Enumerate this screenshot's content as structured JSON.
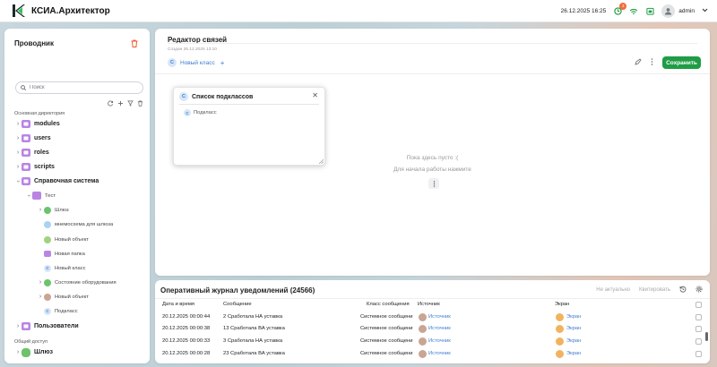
{
  "app": {
    "title": "КСИА.Архитектор"
  },
  "topbar": {
    "datetime": "26.12.2025 16:25",
    "notifications_count": "3",
    "username": "admin"
  },
  "explorer": {
    "title": "Проводник",
    "search_placeholder": "Поиск",
    "section_main": "Основная директория",
    "section_shared": "Общий доступ",
    "items": [
      {
        "label": "modules"
      },
      {
        "label": "users"
      },
      {
        "label": "roles"
      },
      {
        "label": "scripts"
      },
      {
        "label": "Справочная система"
      },
      {
        "label": "Тест"
      },
      {
        "label": "Шлюз"
      },
      {
        "label": "мнемосхема для шлюза"
      },
      {
        "label": "Новый объект"
      },
      {
        "label": "Новая папка"
      },
      {
        "label": "Новый класс"
      },
      {
        "label": "Состояние оборудования"
      },
      {
        "label": "Новый объект"
      },
      {
        "label": "Подкласс"
      },
      {
        "label": "Пользователи"
      },
      {
        "label": "Шлюз"
      }
    ]
  },
  "editor": {
    "title": "Редактор связей",
    "meta": "Создан 26.12.2025 13:10",
    "tab_label": "Новый класс",
    "class_glyph": "C",
    "save_label": "Сохранить",
    "popup": {
      "title": "Список подклассов",
      "item": "Подкласс"
    },
    "empty_line1": "Пока здесь пусто :(",
    "empty_line2": "Для начала работы нажмите"
  },
  "journal": {
    "title": "Оперативный журнал уведомлений (24566)",
    "action_irrelevant": "Не актуально",
    "action_ack": "Квитировать",
    "columns": {
      "datetime": "Дата и время",
      "message": "Сообщение",
      "class": "Класс сообщения",
      "source": "Источник",
      "screen": "Экран"
    },
    "rows": [
      {
        "datetime": "20.12.2025 00:00:44",
        "message": "2 Сработала НА уставка",
        "class": "Системное сообщени",
        "source": "Источник",
        "screen": "Экран"
      },
      {
        "datetime": "20.12.2025 00:00:38",
        "message": "13 Сработала ВА уставка",
        "class": "Системное сообщени",
        "source": "Источник",
        "screen": "Экран"
      },
      {
        "datetime": "20.12.2025 00:00:33",
        "message": "3 Сработала НА уставка",
        "class": "Системное сообщени",
        "source": "Источник",
        "screen": "Экран"
      },
      {
        "datetime": "20.12.2025 00:00:28",
        "message": "23 Сработала ВА уставка",
        "class": "Системное сообщени",
        "source": "Источник",
        "screen": "Экран"
      }
    ]
  },
  "colors": {
    "accent": "#3e7bd1",
    "save": "#1f9d45",
    "folder": "#b985e4",
    "badge": "#f06b3a"
  }
}
